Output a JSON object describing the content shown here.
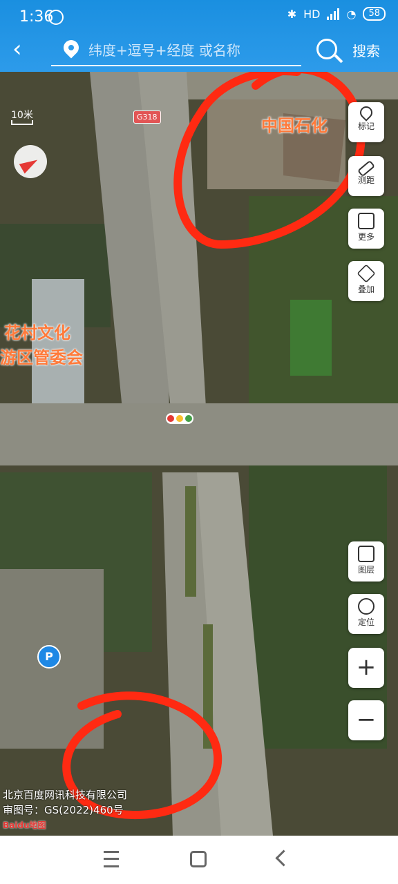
{
  "status_bar": {
    "time": "1:36",
    "network": "HD",
    "battery": "58"
  },
  "header": {
    "search_placeholder": "纬度+逗号+经度 或名称",
    "search_button": "搜索"
  },
  "map": {
    "scale_label": "10米",
    "road_sign": "G318",
    "poi_labels": [
      "中国石化",
      "花村文化",
      "游区管委会"
    ],
    "parking_label": "P",
    "copyright": [
      "北京百度网讯科技有限公司",
      "审图号：GS(2022)460号"
    ],
    "logo": "Baidu地图"
  },
  "controls": {
    "mark": "标记",
    "measure": "测距",
    "more": "更多",
    "overlay": "叠加",
    "layers": "图层",
    "locate": "定位",
    "zoom_in": "+",
    "zoom_out": "−"
  },
  "colors": {
    "header": "#2d9bea",
    "poi": "#ff7a3a",
    "annotation": "#ff2a12"
  }
}
